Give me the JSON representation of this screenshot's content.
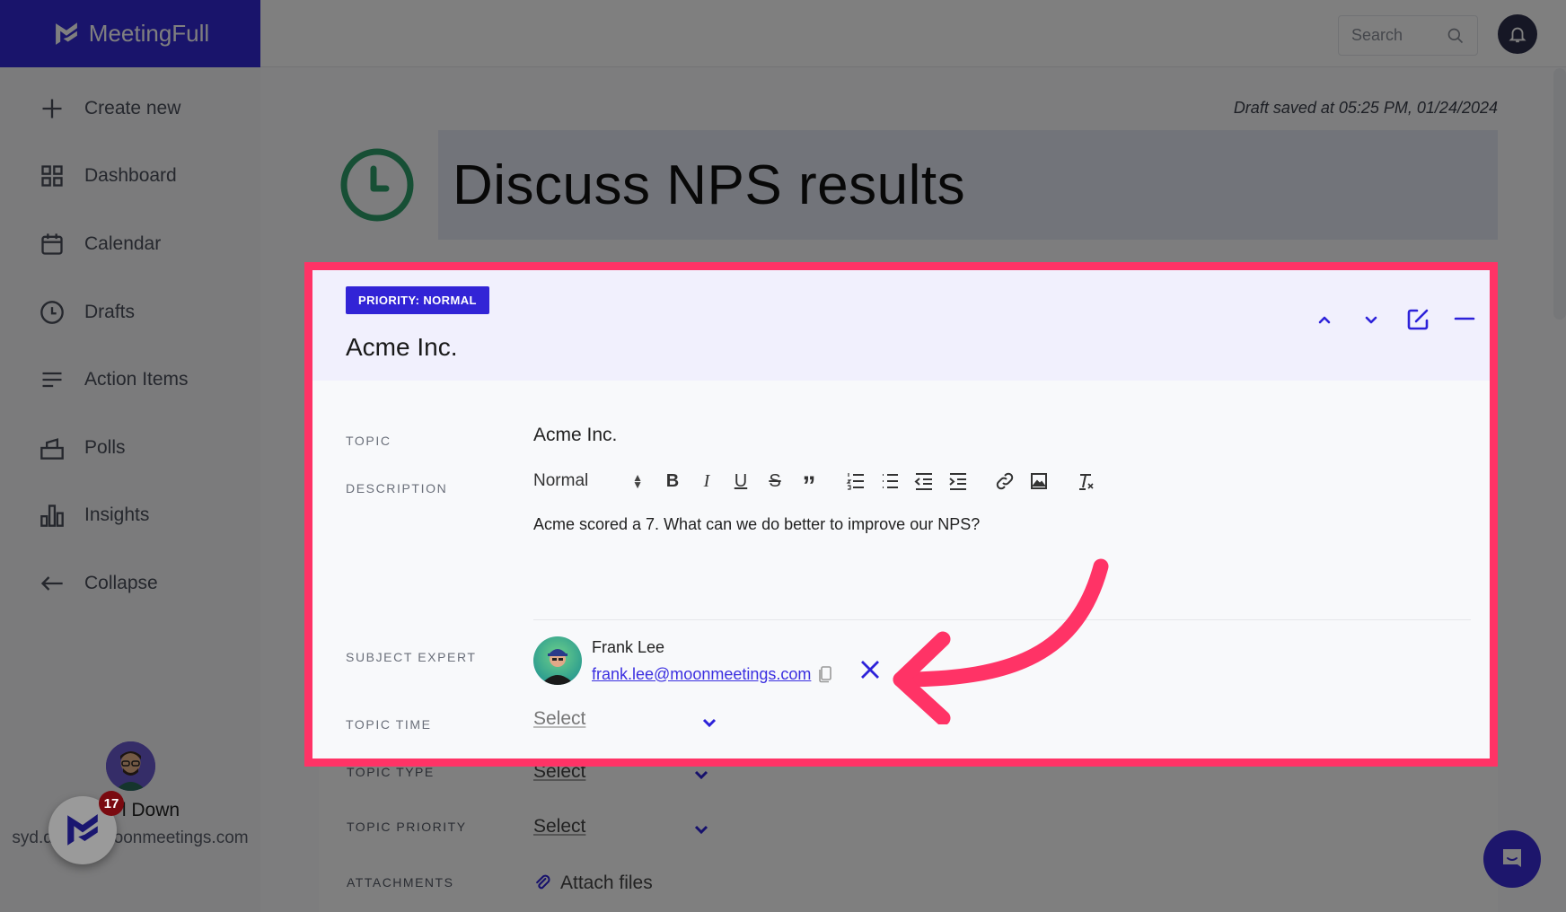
{
  "app": {
    "brand_name": "MeetingFull",
    "sidebar": {
      "items": [
        {
          "label": "Create new",
          "icon": "plus-icon"
        },
        {
          "label": "Dashboard",
          "icon": "grid-icon"
        },
        {
          "label": "Calendar",
          "icon": "calendar-icon"
        },
        {
          "label": "Drafts",
          "icon": "clock-icon"
        },
        {
          "label": "Action Items",
          "icon": "list-icon"
        },
        {
          "label": "Polls",
          "icon": "ballot-box-icon"
        },
        {
          "label": "Insights",
          "icon": "bar-chart-icon"
        },
        {
          "label": "Collapse",
          "icon": "arrow-left-icon"
        }
      ],
      "user": {
        "name": "Syd Down",
        "name_visible": "l Down",
        "email": "syd.down@moonmeetings.com",
        "email_visible_left": "syd.d",
        "email_visible_right": "moonmeetings.com"
      },
      "notification_count": "17"
    },
    "header": {
      "search_placeholder": "Search"
    },
    "draft_saved": "Draft saved at 05:25 PM, 01/24/2024",
    "meeting_title": "Discuss NPS results"
  },
  "topic_card": {
    "priority_badge": "PRIORITY: NORMAL",
    "title": "Acme Inc.",
    "fields": {
      "topic_label": "TOPIC",
      "topic_value": "Acme Inc.",
      "description_label": "DESCRIPTION",
      "description_text": "Acme scored a 7. What can we do better to improve our NPS?",
      "subject_expert_label": "SUBJECT EXPERT",
      "topic_time_label": "TOPIC TIME",
      "topic_time_value": "Select",
      "topic_type_label": "TOPIC TYPE",
      "topic_type_value": "Select",
      "topic_priority_label": "TOPIC PRIORITY",
      "topic_priority_value": "Select",
      "attachments_label": "ATTACHMENTS",
      "attach_files": "Attach files"
    },
    "editor": {
      "format_select": "Normal",
      "buttons": {
        "bold": "B",
        "italic": "I",
        "underline": "U",
        "strike": "S",
        "quote": "”"
      }
    },
    "subject_expert": {
      "name": "Frank Lee",
      "email": "frank.lee@moonmeetings.com"
    }
  },
  "colors": {
    "accent": "#2d22d9",
    "highlight": "#ff3366",
    "clock_green": "#2e9f6a"
  }
}
